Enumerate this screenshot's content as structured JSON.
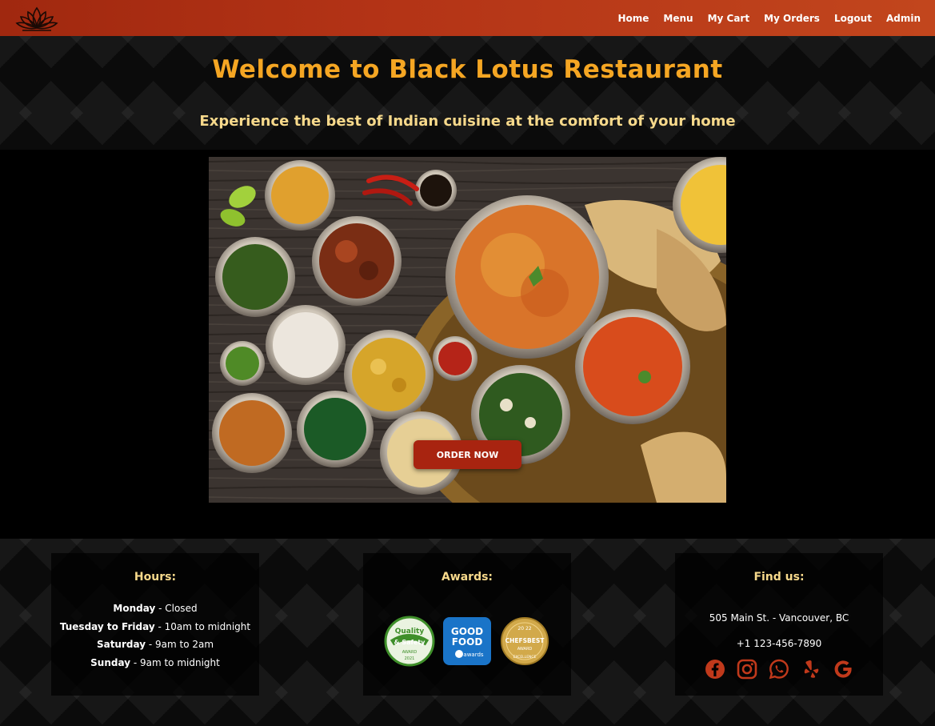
{
  "navbar": {
    "logo_icon": "lotus-icon",
    "links": [
      "Home",
      "Menu",
      "My Cart",
      "My Orders",
      "Logout",
      "Admin"
    ]
  },
  "hero": {
    "title": "Welcome to Black Lotus Restaurant",
    "subtitle": "Experience the best of Indian cuisine at the comfort of your home"
  },
  "banner": {
    "order_button": "ORDER NOW"
  },
  "footer": {
    "hours": {
      "title": "Hours:",
      "rows": [
        {
          "day": "Monday",
          "time": " - Closed"
        },
        {
          "day": "Tuesday to Friday",
          "time": " - 10am to midnight"
        },
        {
          "day": "Saturday",
          "time": " - 9am to 2am"
        },
        {
          "day": "Sunday",
          "time": " - 9am to midnight"
        }
      ]
    },
    "awards": {
      "title": "Awards:",
      "badges": [
        {
          "icon": "quality-safety-award-icon",
          "line1": "Quality",
          "line2": "& Safety",
          "line3": "AWARD",
          "line4": "2021"
        },
        {
          "icon": "good-food-awards-icon",
          "line1": "GOOD",
          "line2": "FOOD",
          "line3": "awards"
        },
        {
          "icon": "chefsbest-award-icon",
          "line1": "20 22",
          "line2": "CHEFSBEST",
          "line3": "AWARD",
          "line4": "EXCELLENCE"
        }
      ]
    },
    "find_us": {
      "title": "Find us:",
      "address": "505 Main St. - Vancouver, BC",
      "phone": "+1 123-456-7890",
      "social_icons": [
        "facebook-icon",
        "instagram-icon",
        "whatsapp-icon",
        "yelp-icon",
        "google-icon"
      ]
    }
  },
  "colors": {
    "navbar": "#b33316",
    "title": "#f5a623",
    "subtitle": "#f7d98b",
    "button": "#a82410",
    "social": "#c0391b"
  }
}
